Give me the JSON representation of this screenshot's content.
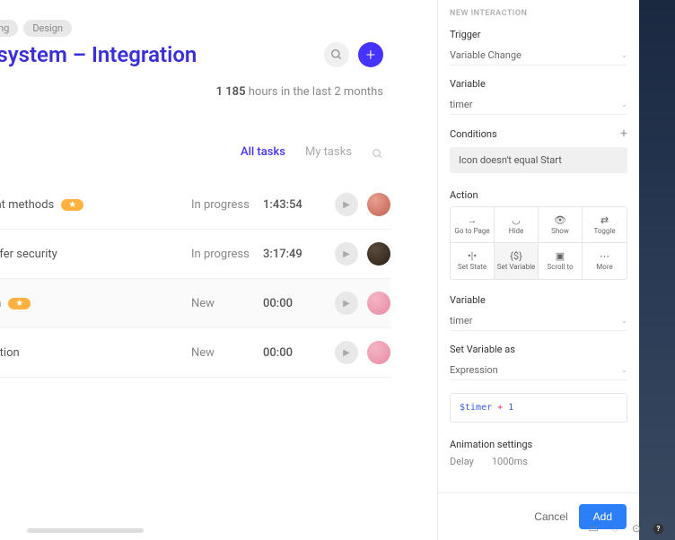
{
  "tags": [
    "eering",
    "Design"
  ],
  "title": "ts system – Integration",
  "summary": {
    "number": "1 185",
    "text": "hours in the last 2 months"
  },
  "tabs": {
    "all": "All tasks",
    "my": "My tasks"
  },
  "tasks": [
    {
      "title": "yment methods",
      "starred": true,
      "status": "In progress",
      "time": "1:43:54",
      "avatar": "av1"
    },
    {
      "title": "transfer security",
      "starred": false,
      "status": "In progress",
      "time": "3:17:49",
      "avatar": "av2"
    },
    {
      "title": "esign",
      "starred": true,
      "status": "New",
      "time": "00:00",
      "avatar": "av3",
      "highlight": true
    },
    {
      "title": "tegration",
      "starred": false,
      "status": "New",
      "time": "00:00",
      "avatar": "av3"
    }
  ],
  "panel": {
    "heading": "New Interaction",
    "trigger_label": "Trigger",
    "trigger_value": "Variable Change",
    "variable_label": "Variable",
    "variable_value": "timer",
    "conditions_label": "Conditions",
    "condition_text": "Icon doesn't equal Start",
    "action_label": "Action",
    "actions": [
      {
        "icon": "→",
        "label": "Go to Page"
      },
      {
        "icon": "◡",
        "label": "Hide"
      },
      {
        "icon": "👁",
        "label": "Show"
      },
      {
        "icon": "⇄",
        "label": "Toggle"
      },
      {
        "icon": "•|•",
        "label": "Set State"
      },
      {
        "icon": "{$}",
        "label": "Set Variable",
        "selected": true
      },
      {
        "icon": "▣",
        "label": "Scroll to"
      },
      {
        "icon": "⋯",
        "label": "More"
      }
    ],
    "variable2_label": "Variable",
    "variable2_value": "timer",
    "setvar_label": "Set Variable as",
    "setvar_type": "Expression",
    "expr_var": "$timer",
    "expr_op": "+",
    "expr_lit": "1",
    "anim_label": "Animation settings",
    "delay_label": "Delay",
    "delay_value": "1000ms",
    "cancel": "Cancel",
    "add": "Add"
  }
}
